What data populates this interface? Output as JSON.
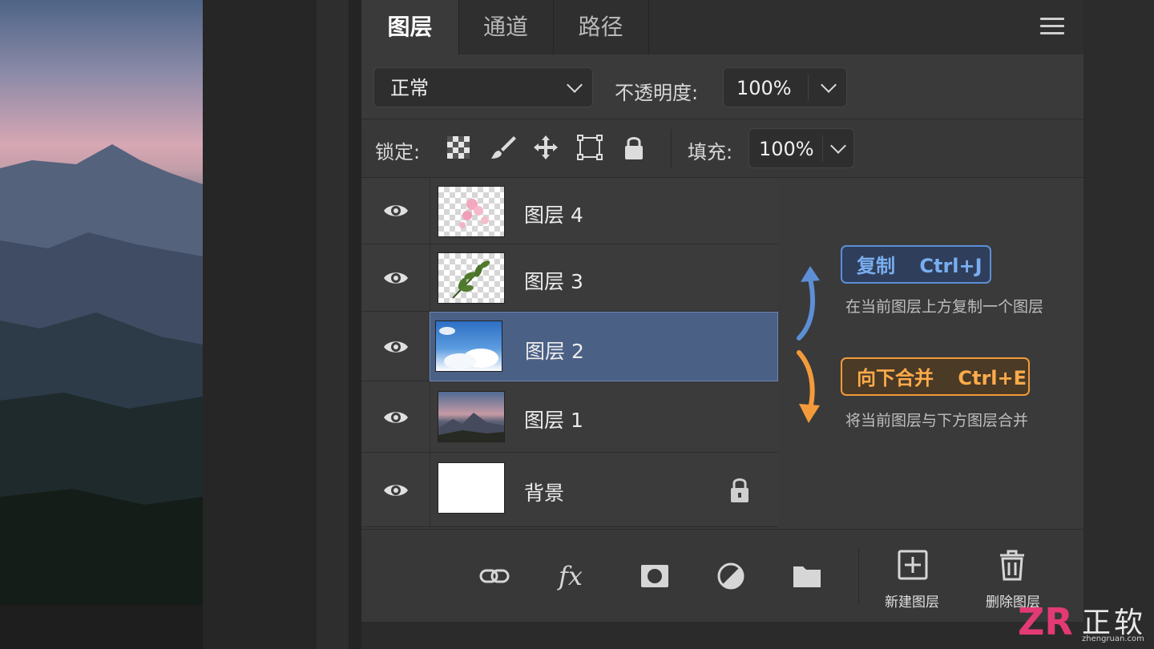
{
  "tabs": [
    {
      "label": "图层",
      "active": true
    },
    {
      "label": "通道",
      "active": false
    },
    {
      "label": "路径",
      "active": false
    }
  ],
  "blend": {
    "mode": "正常",
    "opacity_label": "不透明度:",
    "opacity_value": "100%"
  },
  "lock": {
    "label": "锁定:",
    "fill_label": "填充:",
    "fill_value": "100%",
    "icons": [
      "checkerboard-icon",
      "brush-icon",
      "move-icon",
      "artboard-icon",
      "lock-icon"
    ]
  },
  "layers": [
    {
      "name": "图层 4",
      "visible": true,
      "thumb": "pink-flowers-transparent"
    },
    {
      "name": "图层 3",
      "visible": true,
      "thumb": "green-leaf-transparent"
    },
    {
      "name": "图层 2",
      "visible": true,
      "selected": true,
      "thumb": "blue-sky-clouds"
    },
    {
      "name": "图层 1",
      "visible": true,
      "thumb": "mountain-sunset"
    },
    {
      "name": "背景",
      "visible": true,
      "locked": true,
      "thumb": "white"
    }
  ],
  "annotations": {
    "copy": {
      "label": "复制",
      "shortcut": "Ctrl+J",
      "desc": "在当前图层上方复制一个图层",
      "color": "#5c8fd6"
    },
    "merge": {
      "label": "向下合并",
      "shortcut": "Ctrl+E",
      "desc": "将当前图层与下方图层合并",
      "color": "#f39b3a"
    }
  },
  "toolbar": {
    "icons": [
      "link-icon",
      "fx-icon",
      "mask-icon",
      "adjustment-icon",
      "folder-icon"
    ],
    "new_layer": "新建图层",
    "delete_layer": "删除图层"
  },
  "watermark": {
    "text": "正软",
    "url": "zhengruan.com",
    "logo": "ZR"
  }
}
